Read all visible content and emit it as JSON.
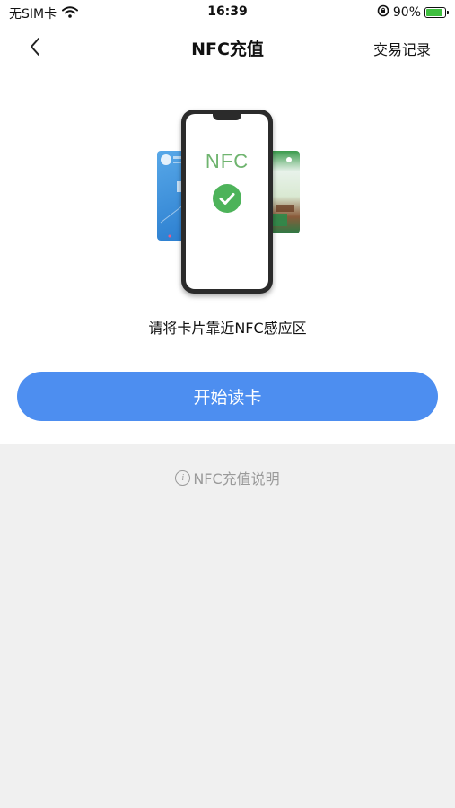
{
  "status_bar": {
    "carrier": "无SIM卡",
    "time": "16:39",
    "battery_percent": "90%",
    "battery_level": 0.9,
    "icons": [
      "wifi-icon",
      "lock-rotation-icon",
      "battery-icon",
      "charging-bolt-icon"
    ]
  },
  "nav": {
    "title": "NFC充值",
    "right_label": "交易记录",
    "back_icon": "chevron-left-icon"
  },
  "illustration": {
    "screen_text": "NFC",
    "icon": "check-icon",
    "accent_color": "#4db35a"
  },
  "main": {
    "hint": "请将卡片靠近NFC感应区",
    "button_label": "开始读卡",
    "button_color": "#4d8ef0"
  },
  "footer": {
    "help_label": "NFC充值说明",
    "help_icon": "info-icon",
    "help_icon_glyph": "i"
  }
}
